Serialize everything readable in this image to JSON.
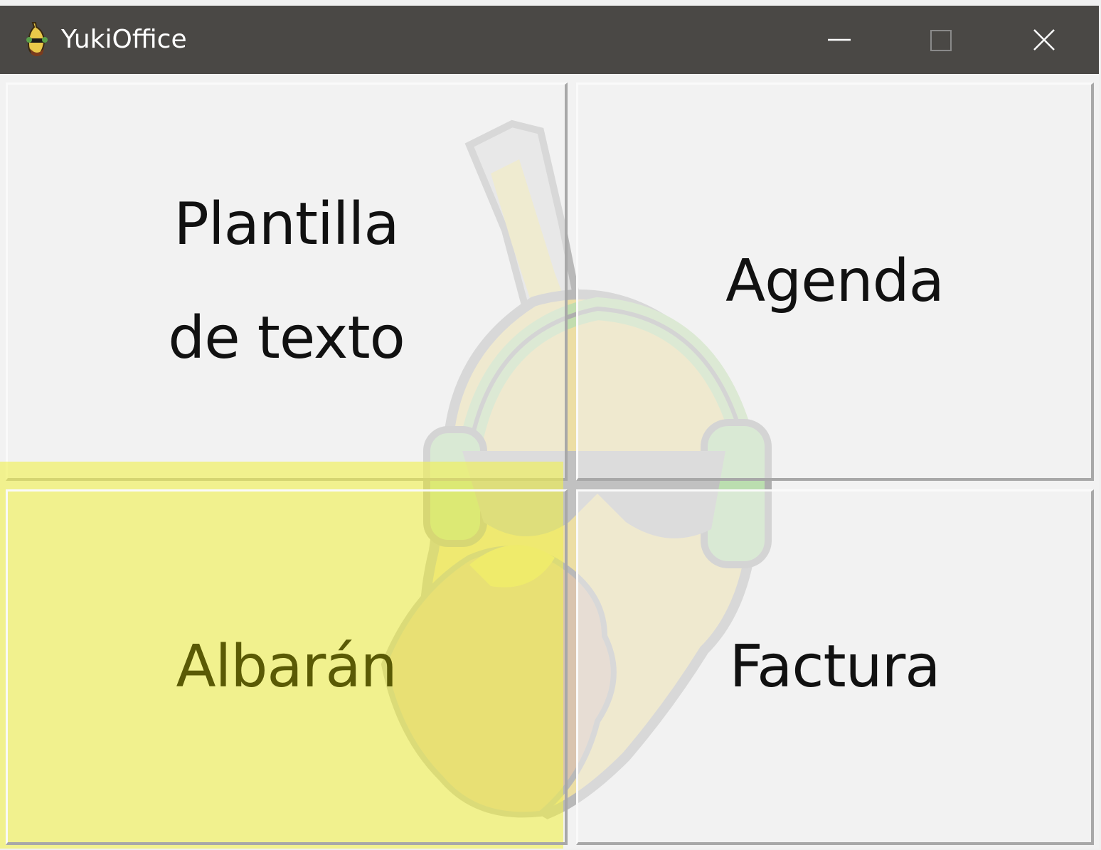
{
  "window": {
    "title": "YukiOffice",
    "controls": {
      "minimize": "minimize-icon",
      "maximize": "maximize-icon",
      "close": "close-icon"
    }
  },
  "tiles": [
    {
      "label": "Plantilla\nde texto"
    },
    {
      "label": "Agenda"
    },
    {
      "label": "Albarán"
    },
    {
      "label": "Factura"
    }
  ],
  "colors": {
    "titlebar": "#4a4845",
    "highlight": "#f0f050",
    "tile_background": "#f3f3f3"
  },
  "background_image": "banana-mascot-with-headphones"
}
